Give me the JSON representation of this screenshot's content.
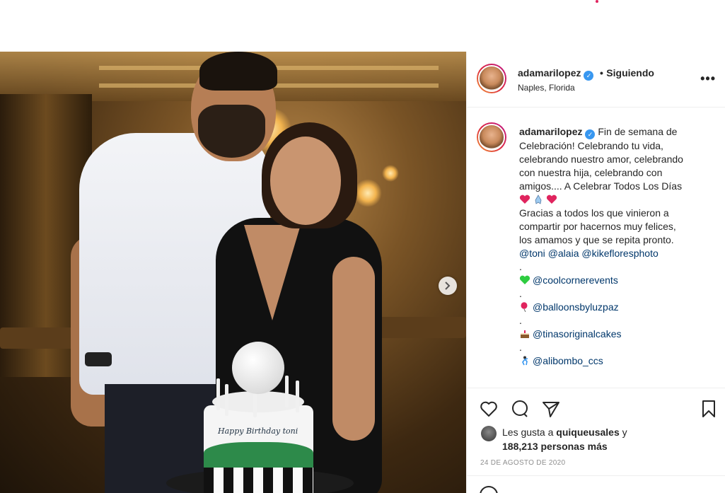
{
  "post": {
    "username": "adamarilopez",
    "follow_separator": "•",
    "follow_label": "Siguiendo",
    "location": "Naples, Florida",
    "more_label": "•••"
  },
  "caption": {
    "username": "adamarilopez",
    "lines": [
      "Fin de semana de",
      "Celebración! Celebrando tu vida,",
      "celebrando nuestro amor, celebrando",
      "con nuestra hija, celebrando con",
      "amigos.... A Celebrar Todos Los Días"
    ],
    "gratitude_lines": [
      "Gracias a todos los que vinieron a",
      "compartir por hacernos muy felices,",
      "los amamos y que se repita pronto."
    ],
    "tags": [
      "@toni",
      "@alaia",
      "@kikefloresphoto"
    ],
    "credits": [
      {
        "icon": "green-heart-icon",
        "handle": "@coolcornerevents"
      },
      {
        "icon": "balloon-icon",
        "handle": "@balloonsbyluzpaz"
      },
      {
        "icon": "cake-icon",
        "handle": "@tinasoriginalcakes"
      },
      {
        "icon": "dancer-icon",
        "handle": "@alibombo_ccs"
      }
    ],
    "dot": "."
  },
  "likes": {
    "prefix": "Les gusta a",
    "user": "quiqueusales",
    "conj": "y",
    "count_text": "188,213 personas más"
  },
  "date": "24 DE AGOSTO DE 2020",
  "photo": {
    "cake_text": "Happy Birthday toni"
  },
  "colors": {
    "accent": "#3897f0",
    "mention": "#00376b",
    "border": "#efefef",
    "muted": "#8e8e8e"
  }
}
